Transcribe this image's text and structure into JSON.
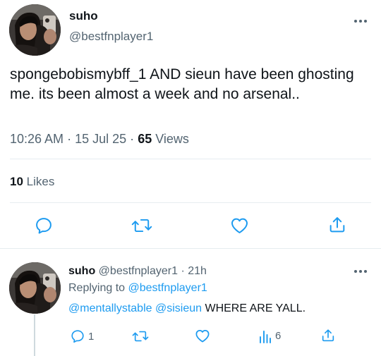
{
  "main_tweet": {
    "author": {
      "display_name": "suho",
      "handle": "@bestfnplayer1"
    },
    "text": "spongebobismybff_1 AND sieun have been ghosting me. its been almost a week and no arsenal..",
    "time": "10:26 AM",
    "separator": "·",
    "date": "15 Jul 25",
    "views_count": "65",
    "views_label": "Views",
    "likes_count": "10",
    "likes_label": "Likes",
    "actions": [
      "reply-icon",
      "retweet-icon",
      "like-icon",
      "share-icon"
    ]
  },
  "reply": {
    "author": {
      "display_name": "suho",
      "handle": "@bestfnplayer1"
    },
    "time": "· 21h",
    "replying_label": "Replying to",
    "replying_to": "@bestfnplayer1",
    "mentions": [
      "@mentallystable",
      "@sisieun"
    ],
    "text": "WHERE ARE YALL.",
    "reply_count": "1",
    "views_count": "6",
    "actions": [
      "reply-icon",
      "retweet-icon",
      "like-icon",
      "views-icon",
      "share-icon"
    ]
  },
  "colors": {
    "text": "#0f1419",
    "secondary": "#536471",
    "link": "#1d9bf0",
    "divider": "#e6ecf0",
    "icon": "#1d9bf0"
  }
}
